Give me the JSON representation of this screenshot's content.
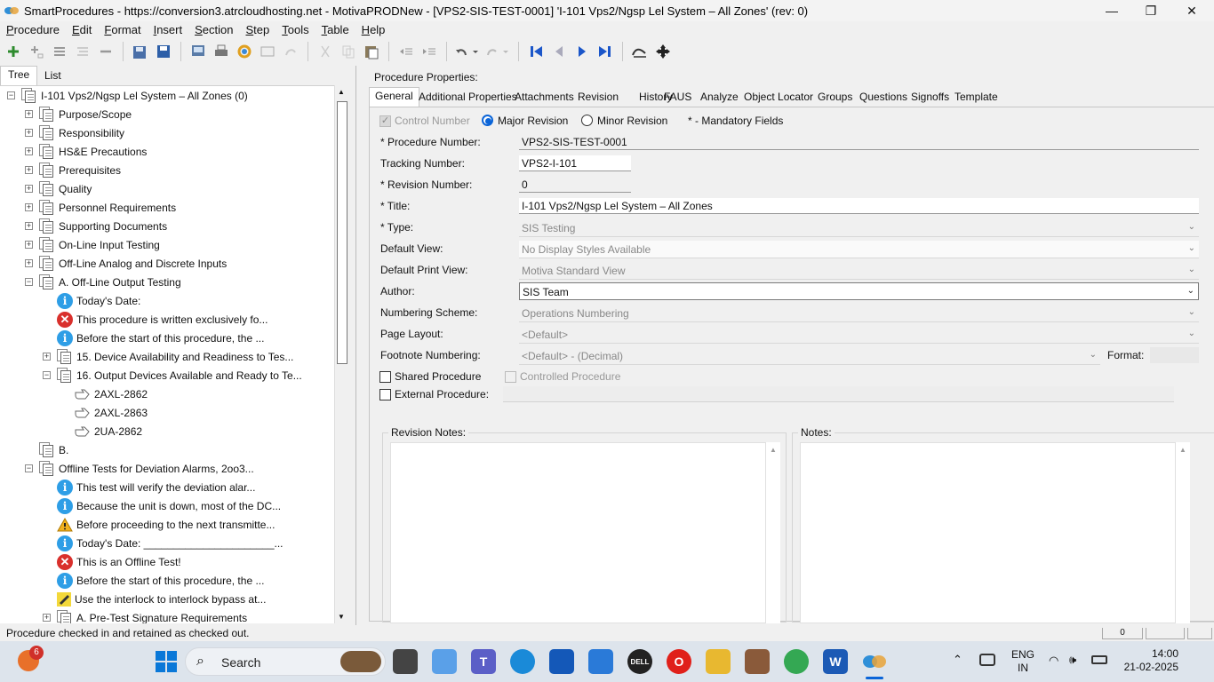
{
  "window": {
    "title": "SmartProcedures - https://conversion3.atrcloudhosting.net - MotivaPRODNew - [VPS2-SIS-TEST-0001] 'I-101 Vps2/Ngsp Lel System – All Zones' (rev: 0)",
    "minimize": "—",
    "maximize": "❐",
    "close": "✕"
  },
  "menu": [
    {
      "u": "P",
      "rest": "rocedure"
    },
    {
      "u": "E",
      "rest": "dit"
    },
    {
      "u": "F",
      "rest": "ormat"
    },
    {
      "u": "I",
      "rest": "nsert"
    },
    {
      "u": "S",
      "rest": "ection"
    },
    {
      "u": "S",
      "rest": "tep"
    },
    {
      "u": "T",
      "rest": "ools"
    },
    {
      "u": "T",
      "rest": "able"
    },
    {
      "u": "H",
      "rest": "elp"
    }
  ],
  "left_tabs": [
    "Tree",
    "List"
  ],
  "tree": [
    {
      "label": "I-101 Vps2/Ngsp Lel System – All Zones (0)",
      "icon": "doc",
      "expander": "−",
      "level": 0
    },
    {
      "label": "Purpose/Scope",
      "icon": "doc",
      "expander": "+",
      "level": 1
    },
    {
      "label": "Responsibility",
      "icon": "doc",
      "expander": "+",
      "level": 1
    },
    {
      "label": "HS&E Precautions",
      "icon": "doc",
      "expander": "+",
      "level": 1
    },
    {
      "label": "Prerequisites",
      "icon": "doc",
      "expander": "+",
      "level": 1
    },
    {
      "label": "Quality",
      "icon": "doc",
      "expander": "+",
      "level": 1
    },
    {
      "label": "Personnel Requirements",
      "icon": "doc",
      "expander": "+",
      "level": 1
    },
    {
      "label": "Supporting Documents",
      "icon": "doc",
      "expander": "+",
      "level": 1
    },
    {
      "label": "On-Line Input Testing",
      "icon": "doc",
      "expander": "+",
      "level": 1
    },
    {
      "label": "Off-Line Analog and Discrete Inputs",
      "icon": "doc",
      "expander": "+",
      "level": 1
    },
    {
      "label": "A. Off-Line Output Testing",
      "icon": "doc",
      "expander": "−",
      "level": 1
    },
    {
      "label": "Today's Date:",
      "icon": "info",
      "expander": "",
      "level": 2
    },
    {
      "label": "This procedure is written exclusively fo...",
      "icon": "err",
      "expander": "",
      "level": 2
    },
    {
      "label": "Before the start of this procedure, the ...",
      "icon": "info",
      "expander": "",
      "level": 2
    },
    {
      "label": "15. Device Availability and Readiness to Tes...",
      "icon": "doc",
      "expander": "+",
      "level": 2
    },
    {
      "label": "16. Output Devices Available and Ready to Te...",
      "icon": "doc",
      "expander": "−",
      "level": 2
    },
    {
      "label": "2AXL-2862",
      "icon": "hand",
      "expander": "",
      "level": 3
    },
    {
      "label": "2AXL-2863",
      "icon": "hand",
      "expander": "",
      "level": 3
    },
    {
      "label": "2UA-2862",
      "icon": "hand",
      "expander": "",
      "level": 3
    },
    {
      "label": "B.",
      "icon": "doc",
      "expander": "",
      "level": 1
    },
    {
      "label": "Offline Tests for Deviation Alarms, 2oo3...",
      "icon": "doc",
      "expander": "−",
      "level": 1
    },
    {
      "label": "This test will verify the deviation alar...",
      "icon": "info",
      "expander": "",
      "level": 2
    },
    {
      "label": "Because the unit is down, most of the DC...",
      "icon": "info",
      "expander": "",
      "level": 2
    },
    {
      "label": "Before proceeding to the next transmitte...",
      "icon": "warn",
      "expander": "",
      "level": 2
    },
    {
      "label": "Today's Date: ______________________...",
      "icon": "info",
      "expander": "",
      "level": 2
    },
    {
      "label": "This is an Offline Test!",
      "icon": "err",
      "expander": "",
      "level": 2
    },
    {
      "label": "Before the start of this procedure, the ...",
      "icon": "info",
      "expander": "",
      "level": 2
    },
    {
      "label": "Use the interlock to interlock bypass at...",
      "icon": "note",
      "expander": "",
      "level": 2
    },
    {
      "label": "A. Pre-Test Signature Requirements",
      "icon": "doc",
      "expander": "+",
      "level": 2
    }
  ],
  "properties_title": "Procedure Properties:",
  "tabs": [
    "General",
    "Additional Properties",
    "Attachments",
    "Revision",
    "History",
    "FAUS",
    "Analyze",
    "Object Locator",
    "Groups",
    "Questions",
    "Signoffs",
    "Template"
  ],
  "general": {
    "control_number": "Control Number",
    "major_revision": "Major Revision",
    "minor_revision": "Minor Revision",
    "mandatory_note": "* - Mandatory Fields",
    "procedure_number_label": "* Procedure Number:",
    "procedure_number": "VPS2-SIS-TEST-0001",
    "tracking_number_label": "Tracking Number:",
    "tracking_number": "VPS2-I-101",
    "revision_number_label": "* Revision Number:",
    "revision_number": "0",
    "title_label": "* Title:",
    "title": "I-101 Vps2/Ngsp Lel System – All Zones",
    "type_label": "* Type:",
    "type": "SIS Testing",
    "default_view_label": "Default View:",
    "default_view": "No Display Styles Available",
    "default_print_view_label": "Default Print View:",
    "default_print_view": "Motiva Standard View",
    "author_label": "Author:",
    "author": "SIS Team",
    "numbering_scheme_label": "Numbering Scheme:",
    "numbering_scheme": "Operations Numbering",
    "page_layout_label": "Page Layout:",
    "page_layout": "<Default>",
    "footnote_numbering_label": "Footnote Numbering:",
    "footnote_numbering": "<Default> - (Decimal)",
    "format_label": "Format:",
    "shared_procedure": "Shared Procedure",
    "controlled_procedure": "Controlled Procedure",
    "external_procedure": "External Procedure:",
    "revision_notes": "Revision Notes:",
    "notes": "Notes:"
  },
  "status": {
    "message": "Procedure checked in and retained as checked out.",
    "panel": "0"
  },
  "taskbar": {
    "search": "Search",
    "lang1": "ENG",
    "lang2": "IN",
    "time": "14:00",
    "date": "21-02-2025",
    "badge": "6"
  },
  "colors": {
    "accent": "#0a64d8",
    "info": "#2e9ee6",
    "error": "#d9302c",
    "navblue": "#1b56c9"
  }
}
